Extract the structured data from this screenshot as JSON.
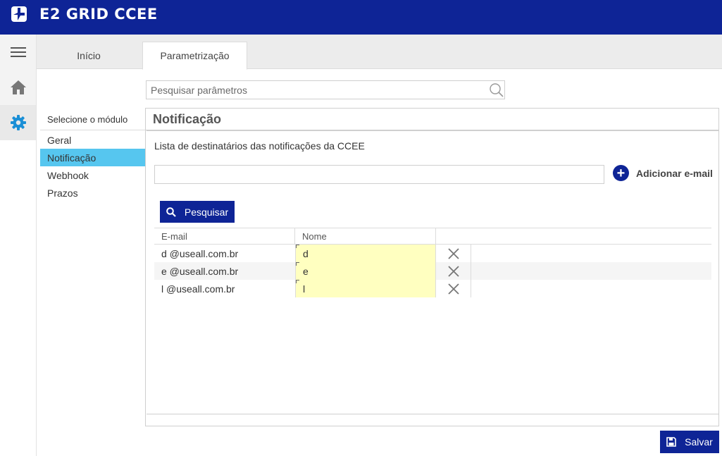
{
  "app": {
    "title": "E2 GRID CCEE"
  },
  "colors": {
    "brand": "#0e2496",
    "active_module": "#56c6ef",
    "name_cell": "#ffffc0"
  },
  "sidenav": {
    "icons": [
      "menu-icon",
      "home-icon",
      "gear-icon"
    ]
  },
  "tabs": [
    {
      "label": "Início"
    },
    {
      "label": "Parametrização",
      "active": true
    }
  ],
  "search": {
    "placeholder": "Pesquisar parâmetros",
    "value": ""
  },
  "modules": {
    "title": "Selecione o módulo",
    "items": [
      {
        "label": "Geral"
      },
      {
        "label": "Notificação",
        "active": true
      },
      {
        "label": "Webhook"
      },
      {
        "label": "Prazos"
      }
    ]
  },
  "panel": {
    "title": "Notificação",
    "list_label": "Lista de destinatários das notificações da CCEE",
    "email_input_value": "",
    "add_label": "Adicionar e-mail",
    "search_label": "Pesquisar"
  },
  "grid": {
    "columns": [
      "E-mail",
      "Nome"
    ],
    "rows": [
      {
        "email": "d        @useall.com.br",
        "nome": "d"
      },
      {
        "email": "e        @useall.com.br",
        "nome": "e"
      },
      {
        "email": "l        @useall.com.br",
        "nome": "l"
      }
    ]
  },
  "footer": {
    "save_label": "Salvar"
  }
}
